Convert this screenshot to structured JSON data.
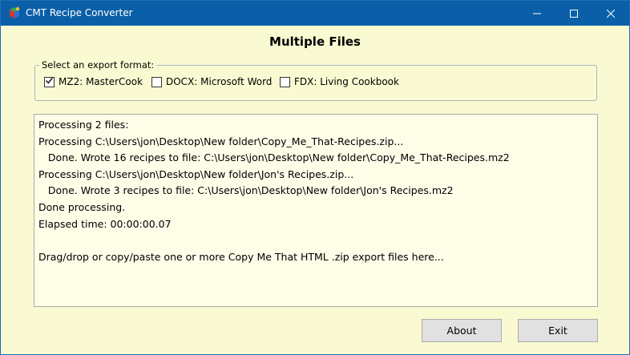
{
  "window": {
    "title": "CMT Recipe Converter",
    "icon": "cmt-app-icon",
    "controls": {
      "minimize_icon": "minimize-icon",
      "maximize_icon": "maximize-icon",
      "close_icon": "close-icon"
    }
  },
  "heading": "Multiple Files",
  "export_format": {
    "legend": "Select an export format:",
    "options": [
      {
        "label": "MZ2: MasterCook",
        "checked": true
      },
      {
        "label": "DOCX: Microsoft Word",
        "checked": false
      },
      {
        "label": "FDX: Living Cookbook",
        "checked": false
      }
    ]
  },
  "log": {
    "lines": [
      "Processing 2 files:",
      "Processing C:\\Users\\jon\\Desktop\\New folder\\Copy_Me_That-Recipes.zip...",
      "   Done. Wrote 16 recipes to file: C:\\Users\\jon\\Desktop\\New folder\\Copy_Me_That-Recipes.mz2",
      "Processing C:\\Users\\jon\\Desktop\\New folder\\Jon's Recipes.zip...",
      "   Done. Wrote 3 recipes to file: C:\\Users\\jon\\Desktop\\New folder\\Jon's Recipes.mz2",
      "Done processing.",
      "Elapsed time: 00:00:00.07",
      "",
      "Drag/drop or copy/paste one or more Copy Me That HTML .zip export files here..."
    ]
  },
  "buttons": {
    "about": "About",
    "exit": "Exit"
  },
  "colors": {
    "titlebar": "#0a5fa8",
    "window_bg": "#fafad2",
    "log_bg": "#fdfde8",
    "button_bg": "#e1e1e1"
  }
}
